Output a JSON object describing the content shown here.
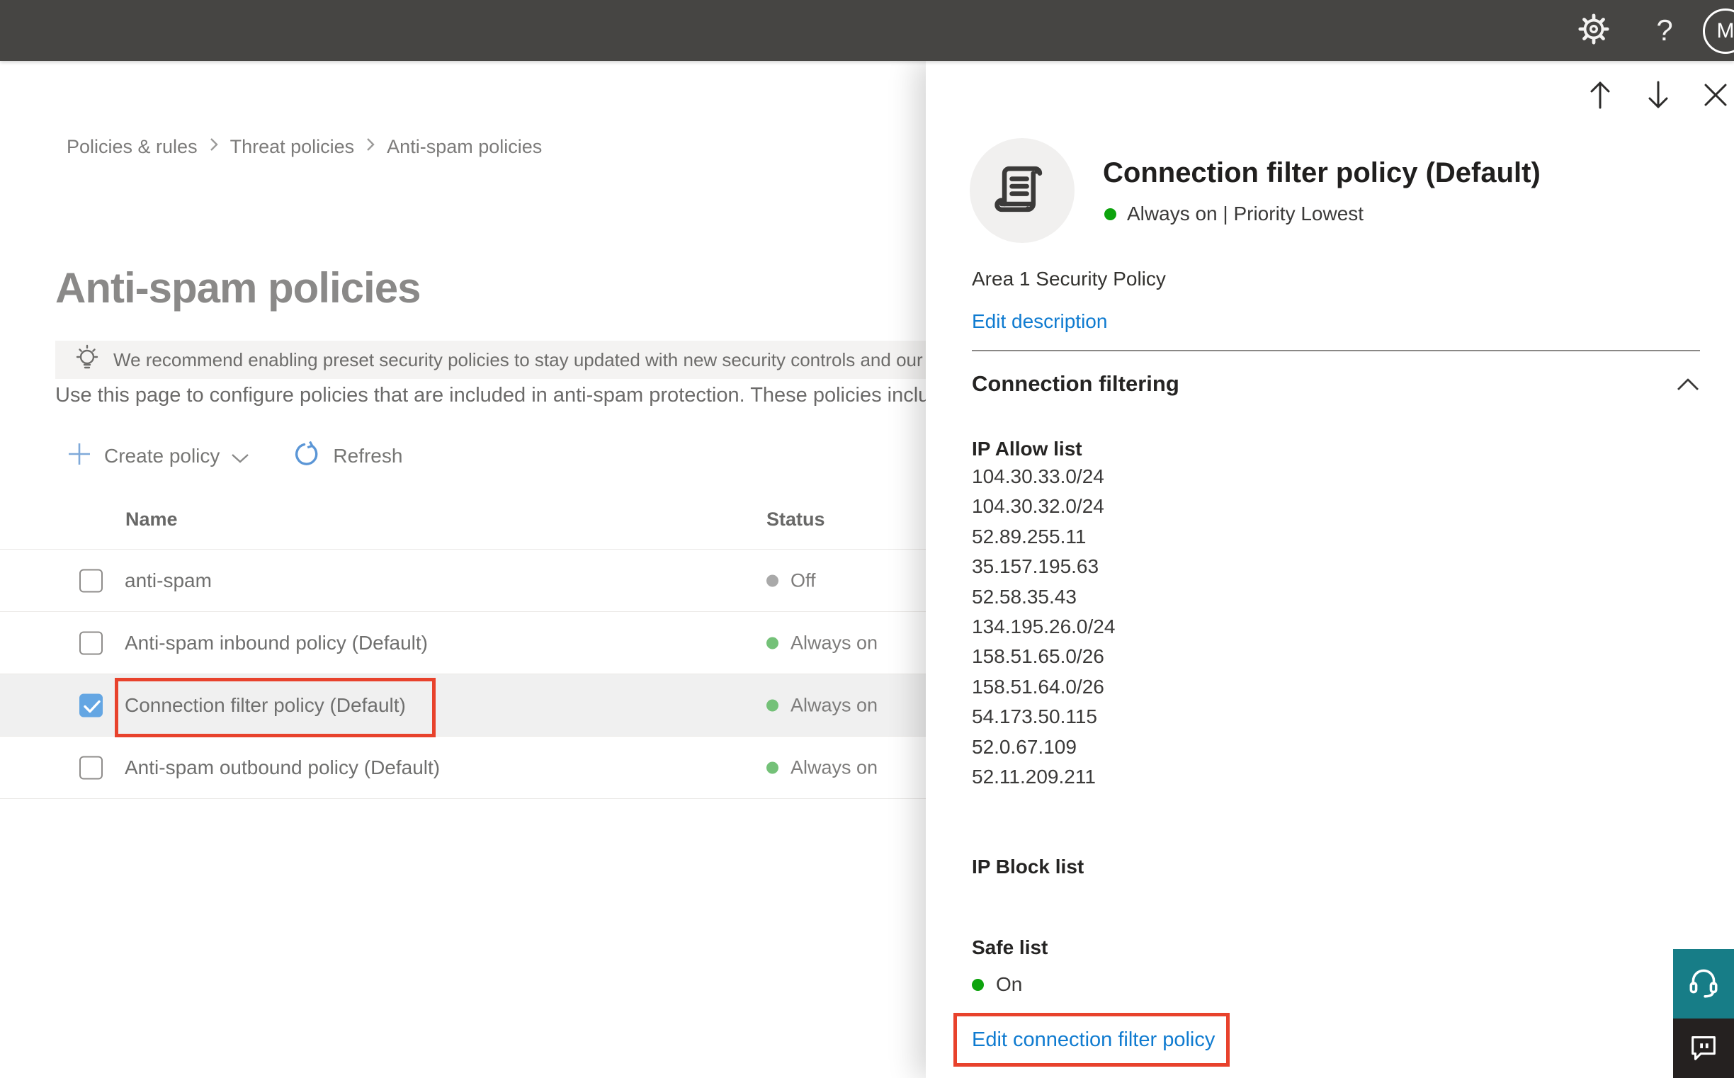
{
  "topbar": {
    "help_label": "?",
    "avatar_initial": "M"
  },
  "breadcrumb": {
    "items": [
      "Policies & rules",
      "Threat policies",
      "Anti-spam policies"
    ]
  },
  "main": {
    "title": "Anti-spam policies",
    "banner": "We recommend enabling preset security policies to stay updated with new security controls and our recomme",
    "description": "Use this page to configure policies that are included in anti-spam protection. These policies include",
    "toolbar": {
      "create_policy": "Create policy",
      "refresh": "Refresh"
    },
    "table": {
      "columns": [
        "Name",
        "Status"
      ],
      "rows": [
        {
          "name": "anti-spam",
          "status": "Off",
          "checked": false,
          "selected": false
        },
        {
          "name": "Anti-spam inbound policy (Default)",
          "status": "Always on",
          "checked": false,
          "selected": false
        },
        {
          "name": "Connection filter policy (Default)",
          "status": "Always on",
          "checked": true,
          "selected": true
        },
        {
          "name": "Anti-spam outbound policy (Default)",
          "status": "Always on",
          "checked": false,
          "selected": false
        }
      ]
    }
  },
  "panel": {
    "title": "Connection filter policy (Default)",
    "status": "Always on | Priority Lowest",
    "description": "Area 1 Security Policy",
    "edit_description": "Edit description",
    "section_title": "Connection filtering",
    "ip_allow_list": {
      "label": "IP Allow list",
      "items": [
        "104.30.33.0/24",
        "104.30.32.0/24",
        "52.89.255.11",
        "35.157.195.63",
        "52.58.35.43",
        "134.195.26.0/24",
        "158.51.65.0/26",
        "158.51.64.0/26",
        "54.173.50.115",
        "52.0.67.109",
        "52.11.209.211"
      ]
    },
    "ip_block_list": {
      "label": "IP Block list"
    },
    "safe_list": {
      "label": "Safe list",
      "value": "On"
    },
    "edit_link": "Edit connection filter policy"
  },
  "colors": {
    "accent_blue": "#0f7bd0",
    "annotation_red": "#e8422c",
    "status_green_panel": "#0da30d",
    "status_green_table": "#74c178",
    "status_gray": "#a9a9a9",
    "topbar_bg": "#464543",
    "support_teal": "#177d87",
    "selected_row_bg": "#f0f0f0"
  }
}
